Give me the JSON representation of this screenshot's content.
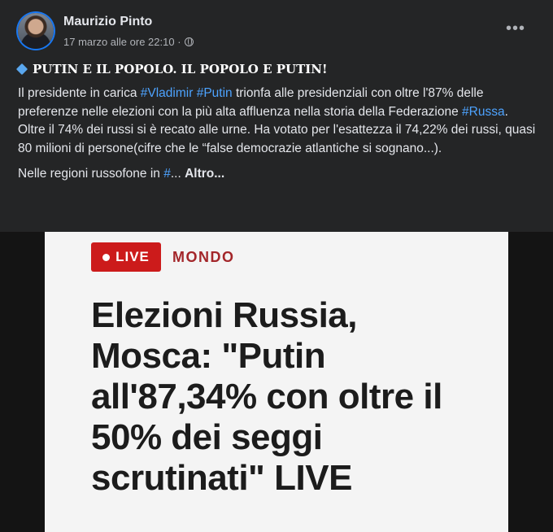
{
  "post": {
    "author": "Maurizio Pinto",
    "timestamp": "17 marzo alle ore 22:10 ·",
    "privacy_icon": "globe-icon",
    "more_label": "•••",
    "title": "PUTIN E IL POPOLO. IL POPOLO E PUTIN!",
    "body": {
      "p1_a": "Il presidente in carica ",
      "hashtag_vladimir": "#Vladimir",
      "p1_space": " ",
      "hashtag_putin": "#Putin",
      "p1_b": " trionfa alle presidenziali con oltre l'87% delle preferenze nelle elezioni con la più alta affluenza nella storia della Federazione ",
      "hashtag_russa": "#Russa",
      "p1_c": ".",
      "p2": "Oltre il 74% dei russi si è recato alle urne. Ha votato per l'esattezza il 74,22% dei russi, quasi 80 milioni di persone(cifre che le “false democrazie atlantiche si sognano...).",
      "p3_a": "Nelle regioni russofone in ",
      "hashtag_trunc": "#",
      "p3_b": "... ",
      "more_link": "Altro..."
    }
  },
  "article": {
    "live_label": "LIVE",
    "category": "MONDO",
    "headline_lines": [
      "Elezioni Russia,",
      "Mosca: \"Putin",
      "all'87,34% con oltre il",
      "50% dei seggi",
      "scrutinati\" LIVE"
    ]
  },
  "colors": {
    "background": "#242526",
    "hashtag": "#4da3ff",
    "live_red": "#cc1b1b",
    "category_red": "#a3262a"
  }
}
